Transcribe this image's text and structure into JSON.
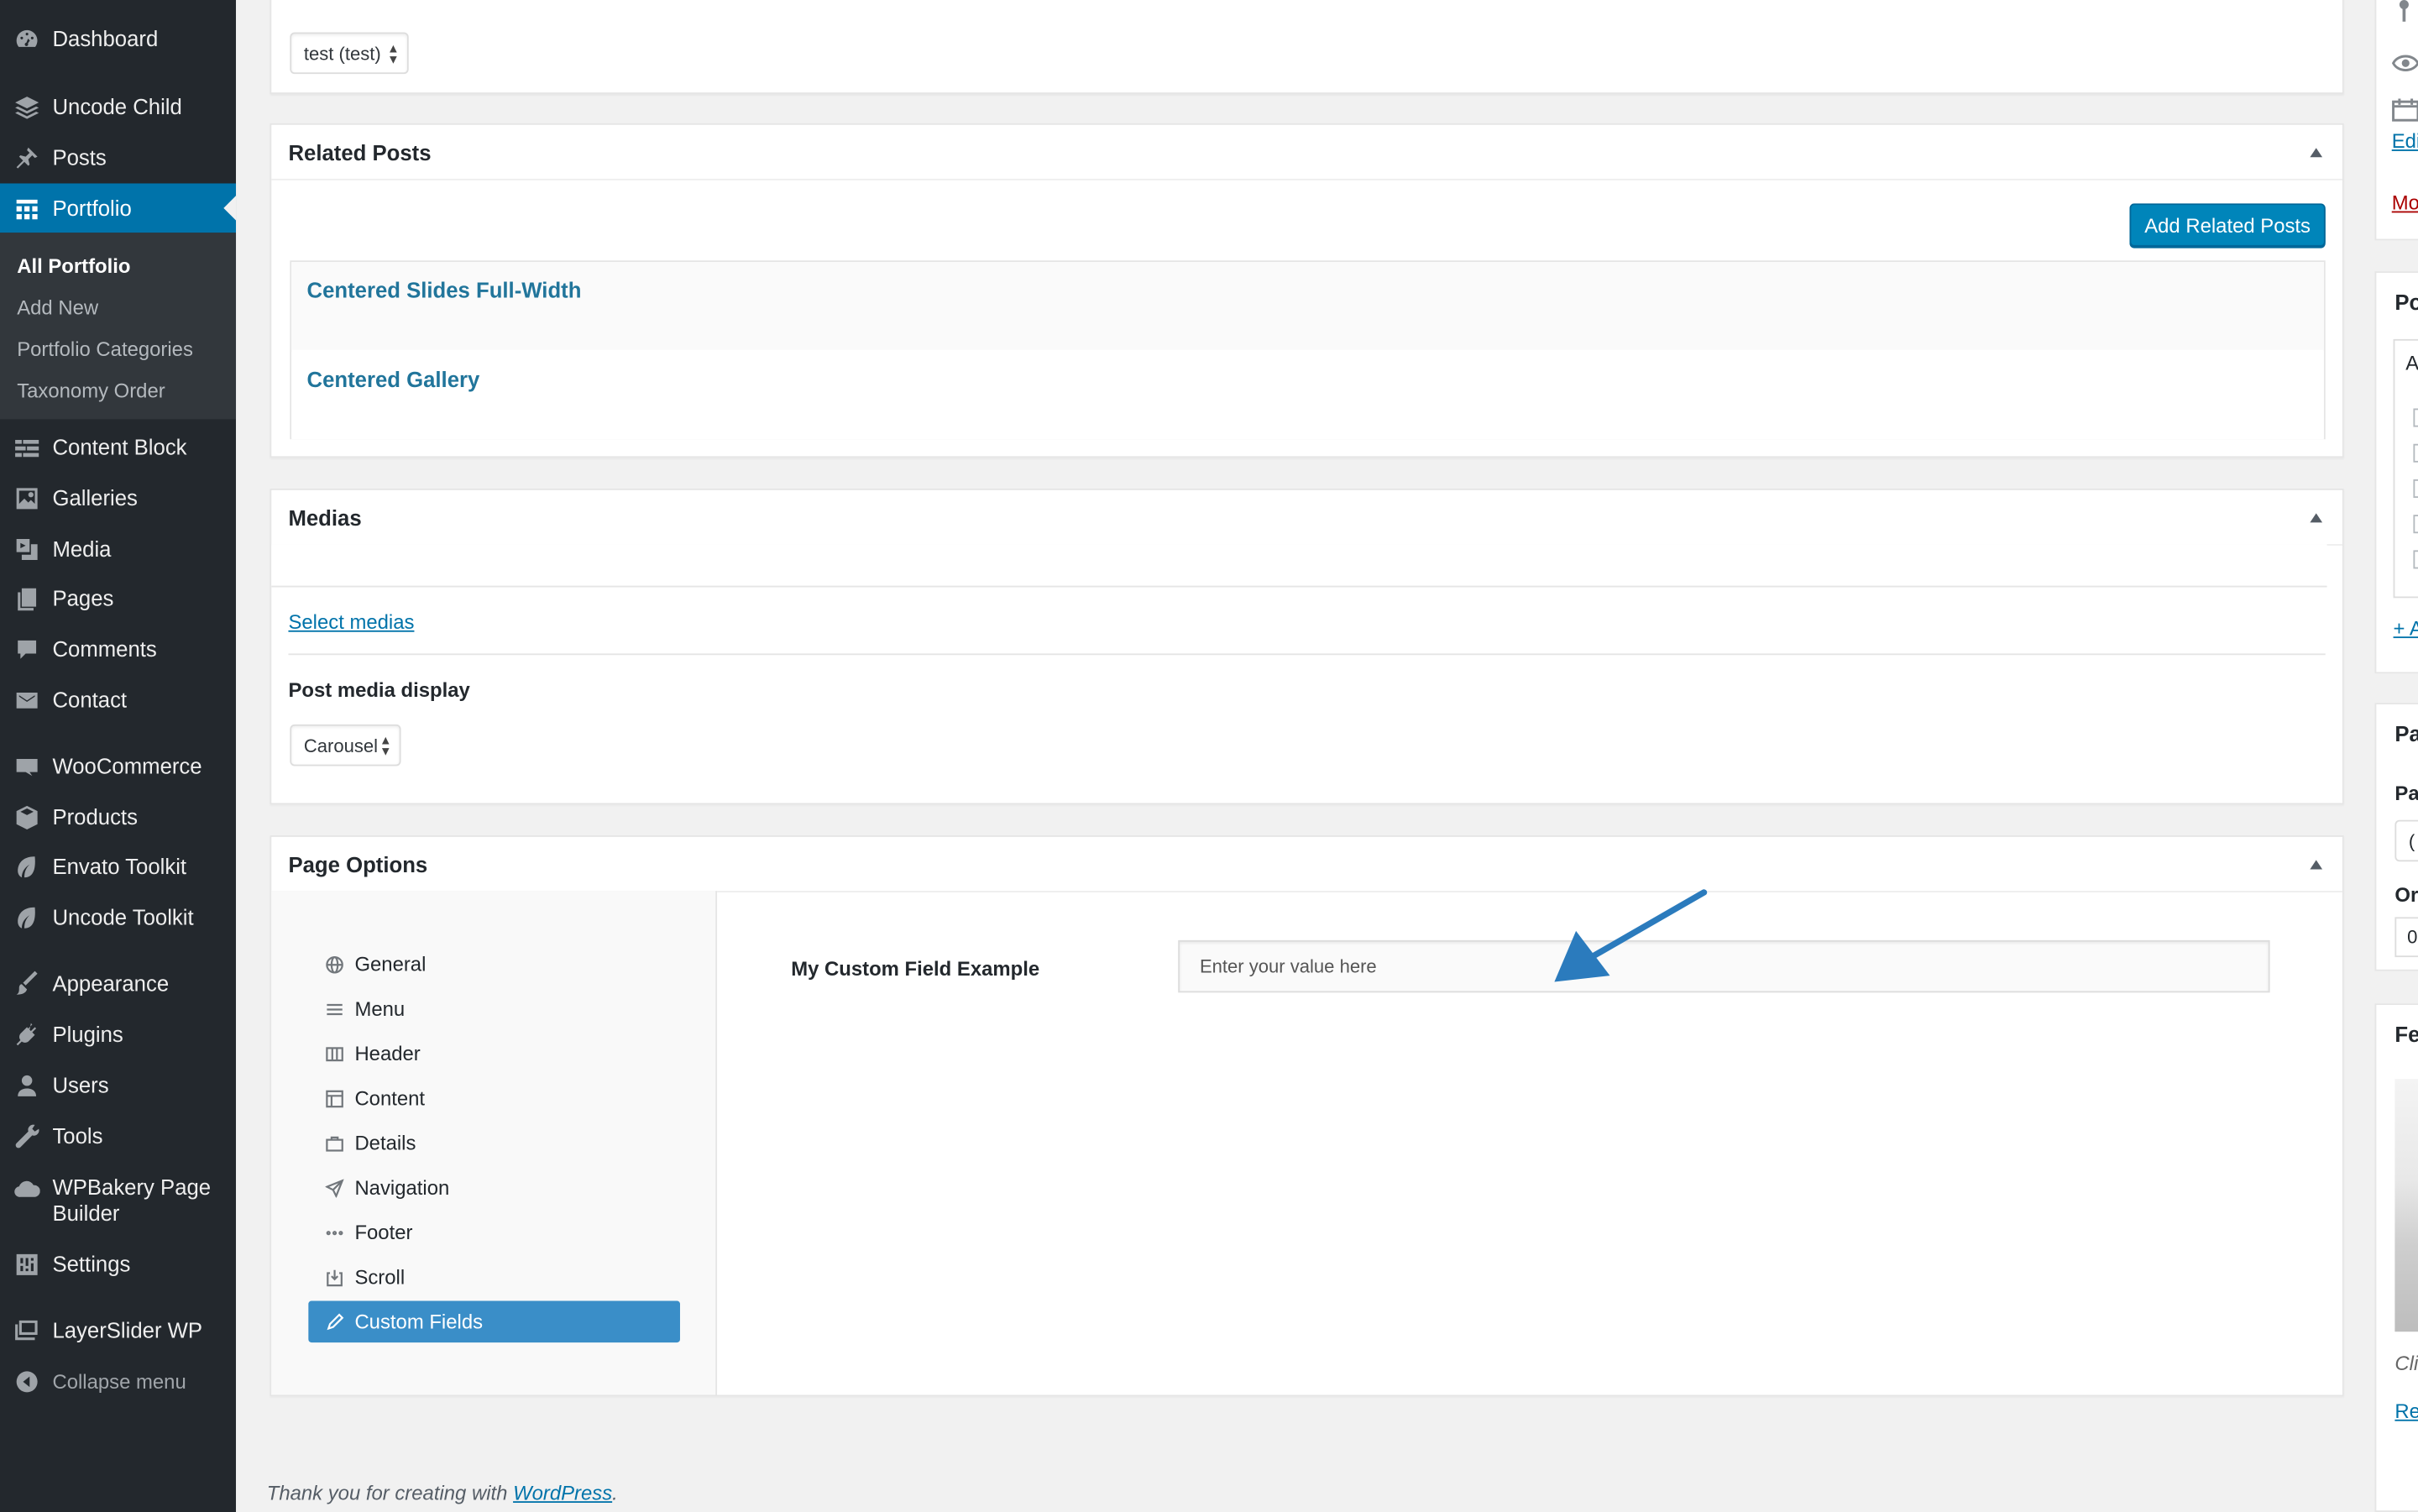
{
  "sidebar": {
    "items": [
      {
        "label": "Dashboard",
        "icon": "dashboard-icon"
      },
      {
        "label": "Uncode Child",
        "icon": "layers-icon"
      },
      {
        "label": "Posts",
        "icon": "pushpin-icon"
      },
      {
        "label": "Portfolio",
        "icon": "portfolio-grid-icon"
      },
      {
        "label": "Content Block",
        "icon": "content-block-icon"
      },
      {
        "label": "Galleries",
        "icon": "gallery-icon"
      },
      {
        "label": "Media",
        "icon": "media-icon"
      },
      {
        "label": "Pages",
        "icon": "pages-icon"
      },
      {
        "label": "Comments",
        "icon": "comment-bubble-icon"
      },
      {
        "label": "Contact",
        "icon": "envelope-icon"
      },
      {
        "label": "WooCommerce",
        "icon": "woocommerce-icon"
      },
      {
        "label": "Products",
        "icon": "box-icon"
      },
      {
        "label": "Envato Toolkit",
        "icon": "leaf-icon"
      },
      {
        "label": "Uncode Toolkit",
        "icon": "leaf-icon"
      },
      {
        "label": "Appearance",
        "icon": "paintbrush-icon"
      },
      {
        "label": "Plugins",
        "icon": "plug-icon"
      },
      {
        "label": "Users",
        "icon": "user-icon"
      },
      {
        "label": "Tools",
        "icon": "wrench-icon"
      },
      {
        "label": "WPBakery Page Builder",
        "icon": "cloud-icon"
      },
      {
        "label": "Settings",
        "icon": "sliders-icon"
      },
      {
        "label": "LayerSlider WP",
        "icon": "layerslider-icon"
      }
    ],
    "collapse_label": "Collapse menu",
    "submenu": [
      "All Portfolio",
      "Add New",
      "Portfolio Categories",
      "Taxonomy Order"
    ]
  },
  "author_box": {
    "select_value": "test (test)"
  },
  "related_posts": {
    "title": "Related Posts",
    "add_button": "Add Related Posts",
    "items": [
      "Centered Slides Full-Width",
      "Centered Gallery"
    ]
  },
  "medias": {
    "title": "Medias",
    "select_link": "Select medias",
    "display_label": "Post media display",
    "display_value": "Carousel"
  },
  "page_options": {
    "title": "Page Options",
    "nav": [
      {
        "label": "General",
        "icon": "globe-icon"
      },
      {
        "label": "Menu",
        "icon": "menu-lines-icon"
      },
      {
        "label": "Header",
        "icon": "header-columns-icon"
      },
      {
        "label": "Content",
        "icon": "layout-icon"
      },
      {
        "label": "Details",
        "icon": "briefcase-icon"
      },
      {
        "label": "Navigation",
        "icon": "paper-plane-icon"
      },
      {
        "label": "Footer",
        "icon": "dots-icon"
      },
      {
        "label": "Scroll",
        "icon": "download-box-icon"
      },
      {
        "label": "Custom Fields",
        "icon": "pencil-icon"
      }
    ],
    "field_label": "My Custom Field Example",
    "field_placeholder": "Enter your value here"
  },
  "footer": {
    "prefix": "Thank you for creating with ",
    "link": "WordPress",
    "suffix": "."
  },
  "right_column": {
    "edit_link": "Edi",
    "move_link": "Mo",
    "box1_title": "Po",
    "box1_option": "Al",
    "add_link": "+ A",
    "box2_title": "Pa",
    "box2_label": "Pa",
    "box2_select": "(",
    "order_label": "Or",
    "order_value": "0",
    "box3_title": "Fe",
    "caption": "Cli",
    "remove_link": "Re"
  },
  "colors": {
    "sidebar_bg": "#23282d",
    "accent": "#0073aa",
    "active_tab": "#3a8ec8",
    "arrow": "#2b7bbd"
  }
}
